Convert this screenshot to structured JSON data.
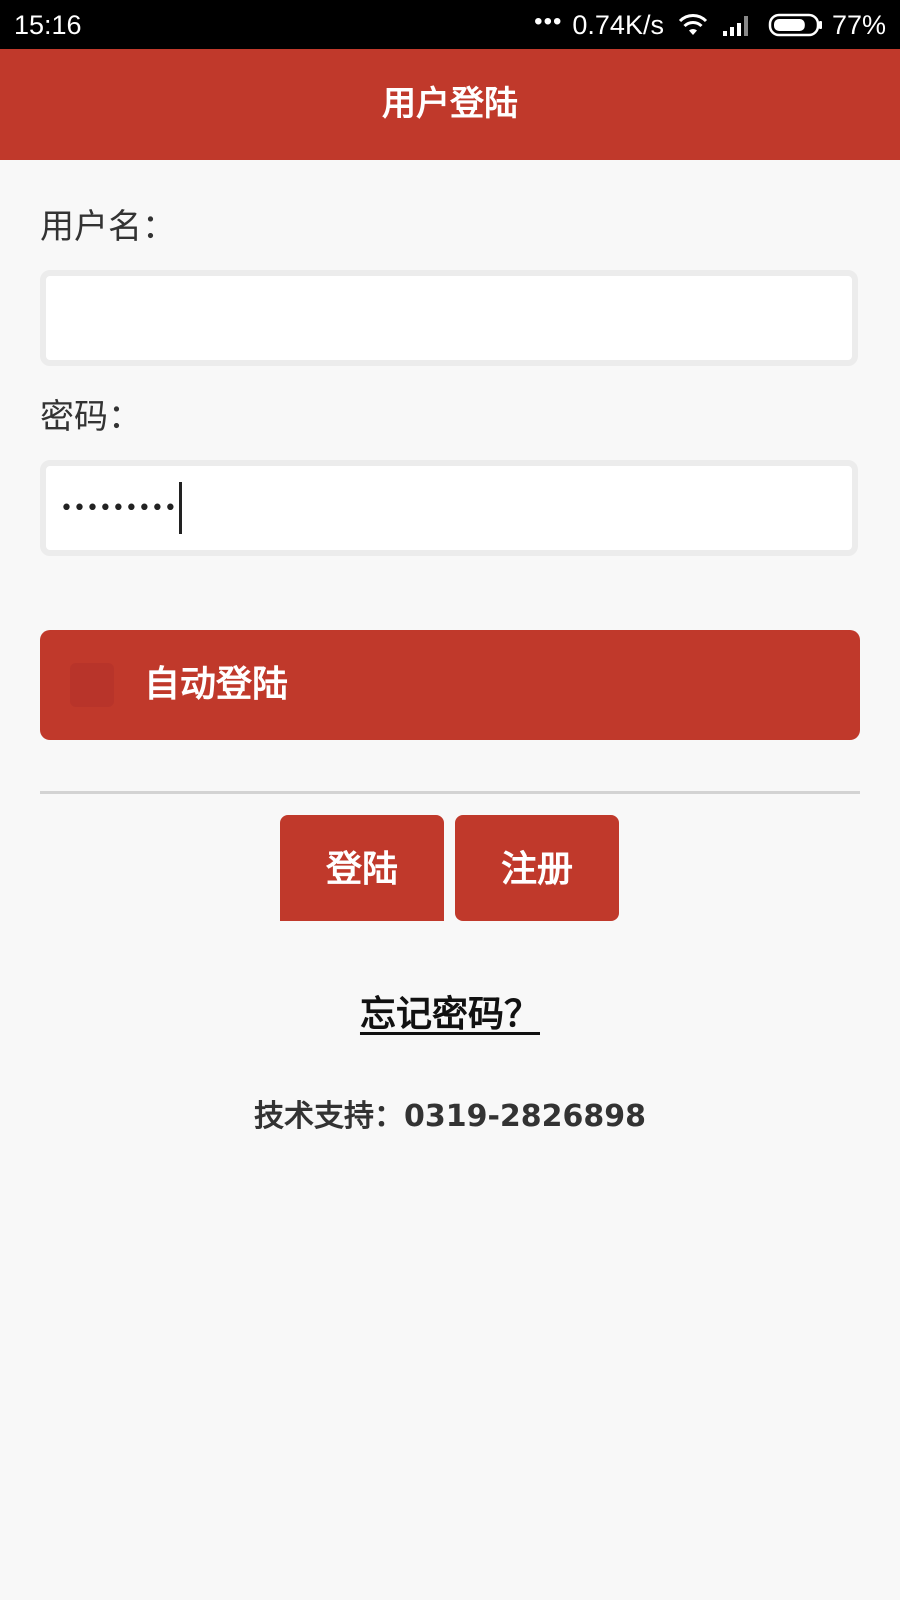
{
  "status_bar": {
    "time": "15:16",
    "dots": "•••",
    "network_speed": "0.74K/s",
    "battery_percent": "77%",
    "battery_level": 0.77,
    "icons": [
      "wifi-icon",
      "signal-icon",
      "battery-icon"
    ]
  },
  "header": {
    "title": "用户登陆"
  },
  "form": {
    "username": {
      "label": "用户名：",
      "value": ""
    },
    "password": {
      "label": "密码：",
      "masked_value": "•••••••••"
    },
    "auto_login": {
      "label": "自动登陆",
      "checked": false
    }
  },
  "buttons": {
    "login_label": "登陆",
    "register_label": "注册"
  },
  "forgot_password": "忘记密码？",
  "support": "技术支持：0319-2826898",
  "colors": {
    "accent": "#c0392b",
    "background": "#f8f8f8",
    "status_bar": "#000000"
  }
}
